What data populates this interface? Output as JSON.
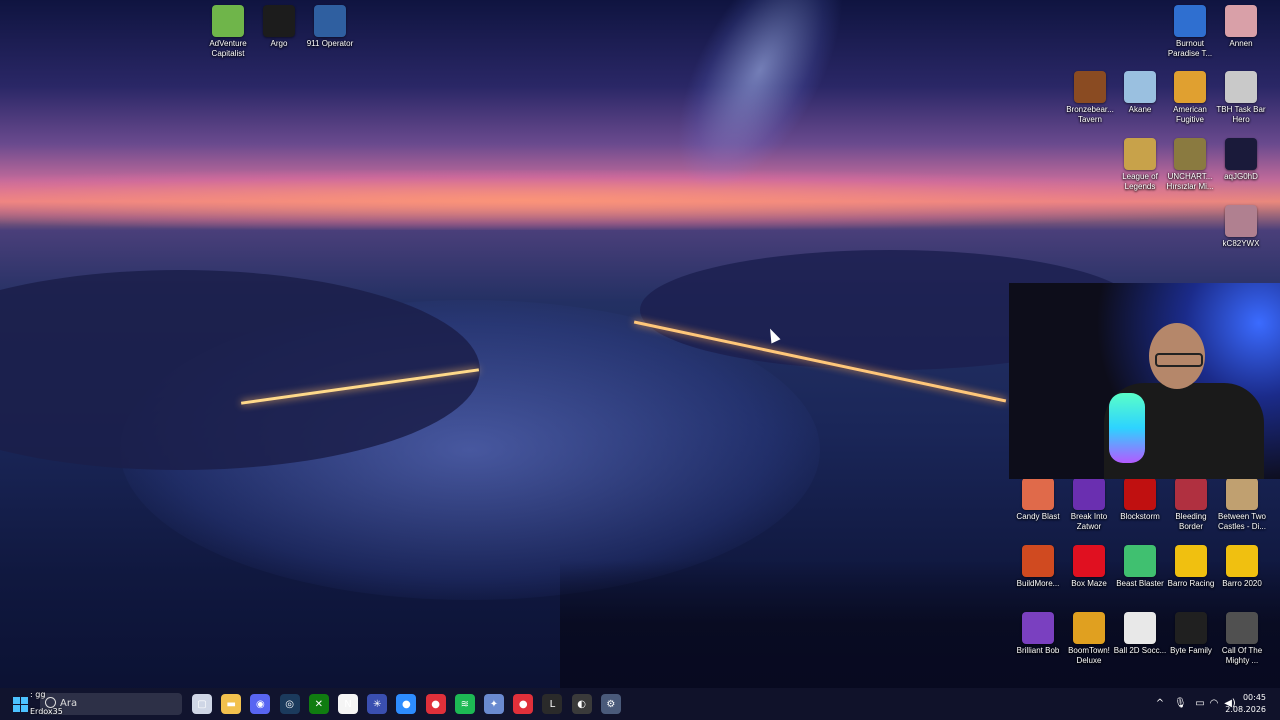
{
  "desktop": {
    "icons_top_left": [
      {
        "label": "AdVenture Capitalist",
        "icon": "adventure-capitalist-icon",
        "color": "#6fb54a"
      },
      {
        "label": "Argo",
        "icon": "argo-icon",
        "color": "#1c1c1c"
      },
      {
        "label": "911 Operator",
        "icon": "911-operator-icon",
        "color": "#2f5fa0"
      }
    ],
    "icons_right": [
      {
        "label": "Burnout Paradise T...",
        "icon": "burnout-paradise-icon",
        "color": "#2f6fd0"
      },
      {
        "label": "Annen",
        "icon": "annen-icon",
        "color": "#d9a0a8"
      },
      {
        "label": "Bronzebear... Tavern",
        "icon": "bronzebeard-tavern-icon",
        "color": "#8a4b22"
      },
      {
        "label": "Akane",
        "icon": "akane-icon",
        "color": "#9ac0e0"
      },
      {
        "label": "American Fugitive",
        "icon": "american-fugitive-icon",
        "color": "#e0a030"
      },
      {
        "label": "TBH Task Bar Hero",
        "icon": "tbh-task-bar-hero-icon",
        "color": "#c9c9c9"
      },
      {
        "label": "League of Legends",
        "icon": "league-of-legends-icon",
        "color": "#c8a24a"
      },
      {
        "label": "UNCHART... Hırsızlar Mi...",
        "icon": "uncharted-icon",
        "color": "#8a7a40"
      },
      {
        "label": "aqJG0hD",
        "icon": "aqjg0hd-icon",
        "color": "#1a1a3a"
      },
      {
        "label": "kC82YWX",
        "icon": "kc82ywx-icon",
        "color": "#b08090"
      }
    ],
    "icons_bottom_right": [
      {
        "label": "Candy Blast",
        "icon": "candy-blast-icon",
        "color": "#e06a4a"
      },
      {
        "label": "Break Into Zatwor",
        "icon": "break-into-zatwor-icon",
        "color": "#6a2fb0"
      },
      {
        "label": "Blockstorm",
        "icon": "blockstorm-icon",
        "color": "#c01010"
      },
      {
        "label": "Bleeding Border",
        "icon": "bleeding-border-icon",
        "color": "#b03040"
      },
      {
        "label": "Between Two Castles - Di...",
        "icon": "between-two-castles-icon",
        "color": "#c0a070"
      },
      {
        "label": "BuildMore...",
        "icon": "buildmore-icon",
        "color": "#d04a20"
      },
      {
        "label": "Box Maze",
        "icon": "box-maze-icon",
        "color": "#e01020"
      },
      {
        "label": "Beast Blaster",
        "icon": "beast-blaster-icon",
        "color": "#40c070"
      },
      {
        "label": "Barro Racing",
        "icon": "barro-racing-icon",
        "color": "#f0c010"
      },
      {
        "label": "Barro 2020",
        "icon": "barro-2020-icon",
        "color": "#f0c010"
      },
      {
        "label": "Brilliant Bob",
        "icon": "brilliant-bob-icon",
        "color": "#7a40c0"
      },
      {
        "label": "BoomTown! Deluxe",
        "icon": "boomtown-deluxe-icon",
        "color": "#e0a020"
      },
      {
        "label": "Ball 2D Socc...",
        "icon": "ball-2d-soccer-icon",
        "color": "#e8e8e8"
      },
      {
        "label": "Byte Family",
        "icon": "byte-family-icon",
        "color": "#202020"
      },
      {
        "label": "Call Of The Mighty ...",
        "icon": "call-of-the-mighty-icon",
        "color": "#505050"
      }
    ]
  },
  "stream_overlay": {
    "chat_line": ": gg",
    "username": "Erdox35"
  },
  "taskbar": {
    "search_placeholder": "Ara",
    "apps": [
      {
        "name": "task-view-icon",
        "glyph": "▢",
        "color": "#cfd6e6"
      },
      {
        "name": "file-explorer-icon",
        "glyph": "▬",
        "color": "#f2c14e"
      },
      {
        "name": "discord-icon",
        "glyph": "◉",
        "color": "#5865f2"
      },
      {
        "name": "steam-icon",
        "glyph": "◎",
        "color": "#1b3a5c"
      },
      {
        "name": "xbox-icon",
        "glyph": "✕",
        "color": "#107c10"
      },
      {
        "name": "notion-icon",
        "glyph": "N",
        "color": "#f5f5f5"
      },
      {
        "name": "sparkle-app-icon",
        "glyph": "✳",
        "color": "#3a4fb0"
      },
      {
        "name": "zoom-app-icon",
        "glyph": "●",
        "color": "#2d8cff"
      },
      {
        "name": "record-app-icon",
        "glyph": "●",
        "color": "#e0303a"
      },
      {
        "name": "spotify-icon",
        "glyph": "≋",
        "color": "#1db954"
      },
      {
        "name": "network-app-icon",
        "glyph": "✦",
        "color": "#6a8ad0"
      },
      {
        "name": "red-app-icon",
        "glyph": "●",
        "color": "#e0303a"
      },
      {
        "name": "league-client-icon",
        "glyph": "L",
        "color": "#2a2a2a"
      },
      {
        "name": "obs-icon",
        "glyph": "◐",
        "color": "#3a3a3a"
      },
      {
        "name": "settings-icon",
        "glyph": "⚙",
        "color": "#4a5a7a"
      }
    ],
    "tray": {
      "chevron": "^",
      "mic": "🎙",
      "display": "▭",
      "wifi": "◠",
      "volume": "◀)"
    },
    "time": "00:45",
    "date": "2.08.2026"
  }
}
